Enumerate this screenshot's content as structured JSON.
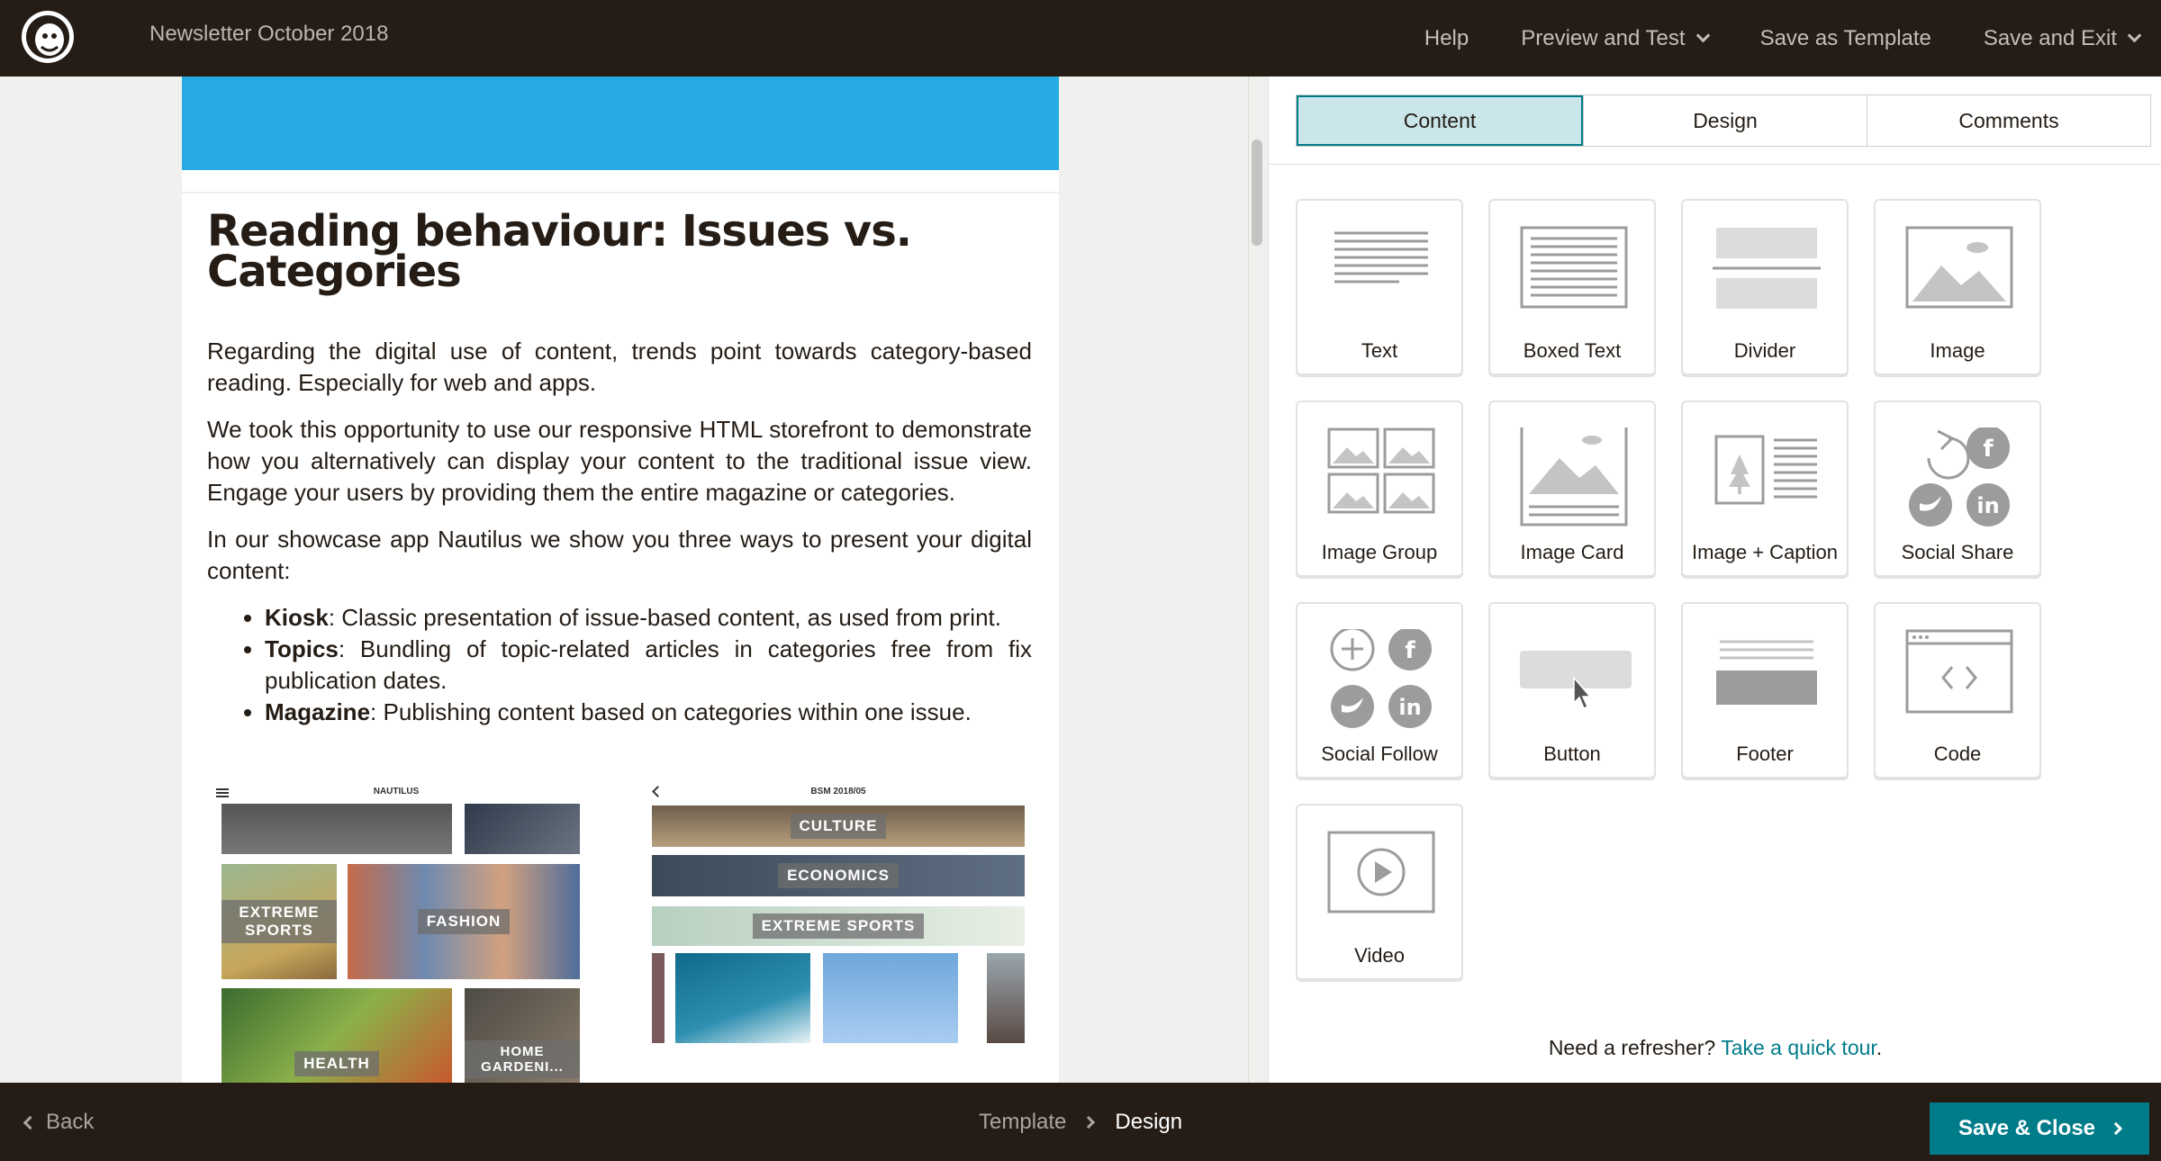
{
  "app": {
    "doc_title": "Newsletter October 2018",
    "logo_icon": "mailchimp-freddie-logo"
  },
  "topnav": {
    "help": "Help",
    "preview_test": "Preview and Test",
    "save_template": "Save as Template",
    "save_exit": "Save and Exit"
  },
  "email": {
    "heading": "Reading behaviour: Issues vs. Categories",
    "p1": "Regarding the digital use of content, trends point towards category-based reading. Especially for web and apps.",
    "p2": "We took this opportunity to use our responsive HTML storefront to demonstrate how you alternatively can display your content to the traditional issue view. Engage your users by providing them the entire magazine or categories.",
    "p3": "In our showcase app Nautilus we show you three ways to present your digital content:",
    "bullets": [
      {
        "term": "Kiosk",
        "text": ": Classic presentation of issue-based content, as used from print."
      },
      {
        "term": "Topics",
        "text": ": Bundling of topic-related articles in categories free from fix publication dates."
      },
      {
        "term": "Magazine",
        "text": ": Publishing content based on categories within one issue."
      }
    ],
    "phone1": {
      "header": "NAUTILUS",
      "tiles": [
        "EXTREME SPORTS",
        "FASHION",
        "HEALTH",
        "HOME GARDENI..."
      ]
    },
    "phone2": {
      "header": "BSM 2018/05",
      "tiles": [
        "CULTURE",
        "ECONOMICS",
        "EXTREME SPORTS"
      ]
    },
    "hero_color": "#27a9e3"
  },
  "tabs": [
    "Content",
    "Design",
    "Comments"
  ],
  "blocks": [
    {
      "label": "Text",
      "icon": "text-block-icon"
    },
    {
      "label": "Boxed Text",
      "icon": "boxed-text-block-icon"
    },
    {
      "label": "Divider",
      "icon": "divider-block-icon"
    },
    {
      "label": "Image",
      "icon": "image-block-icon"
    },
    {
      "label": "Image Group",
      "icon": "image-group-block-icon"
    },
    {
      "label": "Image Card",
      "icon": "image-card-block-icon"
    },
    {
      "label": "Image + Caption",
      "icon": "image-caption-block-icon"
    },
    {
      "label": "Social Share",
      "icon": "social-share-block-icon"
    },
    {
      "label": "Social Follow",
      "icon": "social-follow-block-icon"
    },
    {
      "label": "Button",
      "icon": "button-block-icon"
    },
    {
      "label": "Footer",
      "icon": "footer-block-icon"
    },
    {
      "label": "Code",
      "icon": "code-block-icon"
    },
    {
      "label": "Video",
      "icon": "video-block-icon"
    }
  ],
  "refresher": {
    "text": "Need a refresher?",
    "link": "Take a quick tour",
    "end": "."
  },
  "bottombar": {
    "back": "Back",
    "crumb_template": "Template",
    "crumb_design": "Design",
    "save_close": "Save & Close"
  },
  "colors": {
    "brand_dark": "#241c15",
    "accent_teal": "#007c89",
    "active_tab_bg": "#cae6ea"
  }
}
